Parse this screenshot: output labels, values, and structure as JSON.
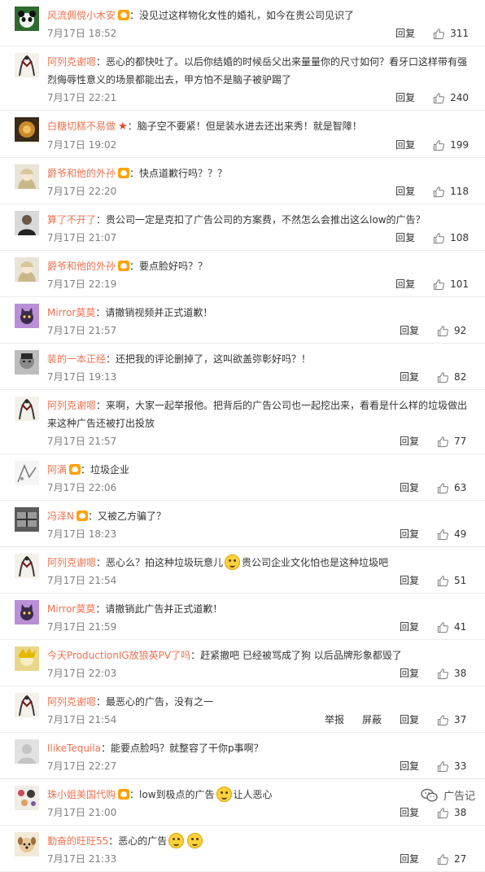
{
  "labels": {
    "reply": "回复",
    "report": "举报",
    "block": "屏蔽"
  },
  "watermark": {
    "text": "广告记"
  },
  "comments": [
    {
      "user": "风流倜傥小木安",
      "badge": true,
      "text": "没见过这样物化女性的婚礼，如今在贵公司见识了",
      "time": "7月17日 18:52",
      "likes": "311",
      "avatar": "panda-avatar"
    },
    {
      "user": "阿列克谢嗯",
      "text": "恶心的都快吐了。以后你结婚的时候岳父出来量量你的尺寸如何？看牙口这样带有强烈侮辱性意义的场景都能出去，甲方怕不是脑子被驴踢了",
      "time": "7月17日 22:21",
      "likes": "240",
      "avatar": "ink-avatar"
    },
    {
      "user": "白糖切糕不易做",
      "vip": true,
      "text": "脑子空不要紧！但是装水进去还出来秀！就是智障！",
      "time": "7月17日 19:02",
      "likes": "199",
      "avatar": "cake-avatar"
    },
    {
      "user": "爵爷和他的外孙",
      "badge": true,
      "text": "快点道歉行吗？？？",
      "time": "7月17日 22:20",
      "likes": "118",
      "avatar": "anime-avatar"
    },
    {
      "user": "算了不开了",
      "text": "贵公司一定是克扣了广告公司的方案费，不然怎么会推出这么low的广告？",
      "time": "7月17日 21:07",
      "likes": "108",
      "avatar": "man-avatar"
    },
    {
      "user": "爵爷和他的外孙",
      "badge": true,
      "text": "要点脸好吗？？",
      "time": "7月17日 22:19",
      "likes": "101",
      "avatar": "anime-avatar"
    },
    {
      "user": "Mirror莫莫",
      "text": "请撤销视频并正式道歉！",
      "time": "7月17日 21:57",
      "likes": "92",
      "avatar": "cat-avatar"
    },
    {
      "user": "装的一本正经",
      "text": "还把我的评论删掉了，这叫欲盖弥彰好吗？！",
      "time": "7月17日 19:13",
      "likes": "82",
      "avatar": "face-avatar"
    },
    {
      "user": "阿列克谢嗯",
      "text": "来啊，大家一起举报他。把背后的广告公司也一起挖出来，看看是什么样的垃圾做出来这种广告还被打出投放",
      "time": "7月17日 21:57",
      "likes": "77",
      "avatar": "ink-avatar"
    },
    {
      "user": "阿满",
      "badge": true,
      "text": "垃圾企业",
      "time": "7月17日 22:06",
      "likes": "63",
      "avatar": "sketch-avatar"
    },
    {
      "user": "冯泽N",
      "badge": true,
      "text": "又被乙方骗了？",
      "time": "7月17日 18:23",
      "likes": "49",
      "avatar": "window-avatar"
    },
    {
      "user": "阿列克谢嗯",
      "text": "恶心么？拍这种垃圾玩意儿",
      "emoji": 1,
      "text2": "贵公司企业文化怕也是这种垃圾吧",
      "time": "7月17日 21:54",
      "likes": "51",
      "avatar": "ink-avatar"
    },
    {
      "user": "Mirror莫莫",
      "text": "请撤销此广告并正式道歉！",
      "time": "7月17日 21:59",
      "likes": "41",
      "avatar": "cat-avatar"
    },
    {
      "user": "今天ProductionIG放狼英PV了吗",
      "text": "赶紧撤吧 已经被骂成了狗 以后品牌形象都毁了",
      "time": "7月17日 22:03",
      "likes": "38",
      "avatar": "yellow-avatar"
    },
    {
      "user": "阿列克谢嗯",
      "text": "最恶心的广告，没有之一",
      "time": "7月17日 21:54",
      "likes": "37",
      "avatar": "ink-avatar",
      "extra": true
    },
    {
      "user": "IlikeTequila",
      "text": "能要点脸吗？就整容了干你p事啊？",
      "time": "7月17日 22:27",
      "likes": "33",
      "avatar": "default-avatar"
    },
    {
      "user": "珠小姐美国代购",
      "badge": true,
      "text": "low到极点的广告",
      "emoji": 1,
      "text2": "让人恶心",
      "time": "7月17日 21:00",
      "likes": "38",
      "avatar": "dots-avatar"
    },
    {
      "user": "勤奋的旺旺55",
      "text": "恶心的广告",
      "emoji": 2,
      "text2": "",
      "time": "7月17日 21:33",
      "likes": "27",
      "avatar": "dog-avatar"
    }
  ]
}
